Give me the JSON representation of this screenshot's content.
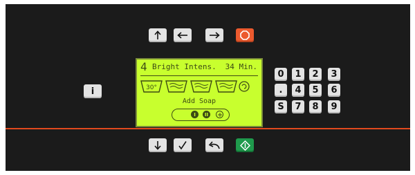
{
  "colors": {
    "panel": "#1b1b1b",
    "divider": "#e24a1e",
    "lcd": "#c8ff2e",
    "lcd_ink": "#3c4a14",
    "stop_button": "#ec5a2e",
    "start_button": "#1f9a4c",
    "key": "#e3e3e3"
  },
  "nav": {
    "up_icon": "arrow-up-icon",
    "left_icon": "arrow-left-icon",
    "right_icon": "arrow-right-icon",
    "stop_icon": "stop-octagon-icon"
  },
  "info": {
    "label": "i"
  },
  "display": {
    "program_number": "4",
    "program_name": "Bright Intens.",
    "time": "34 Min.",
    "temperature": "30°",
    "step_icons": [
      "wash-tub-icon",
      "wash-tub-icon",
      "wash-tub-icon",
      "wash-tub-icon",
      "spin-icon"
    ],
    "message": "Add Soap",
    "soap_compartments": [
      "I",
      "II",
      "softener"
    ]
  },
  "keypad": {
    "rows": [
      [
        "0",
        "1",
        "2",
        "3"
      ],
      [
        ".",
        "4",
        "5",
        "6"
      ],
      [
        "S",
        "7",
        "8",
        "9"
      ]
    ]
  },
  "bottom": {
    "down_icon": "arrow-down-icon",
    "check_icon": "check-icon",
    "back_icon": "back-arrow-icon",
    "start_icon": "start-diamond-icon"
  }
}
